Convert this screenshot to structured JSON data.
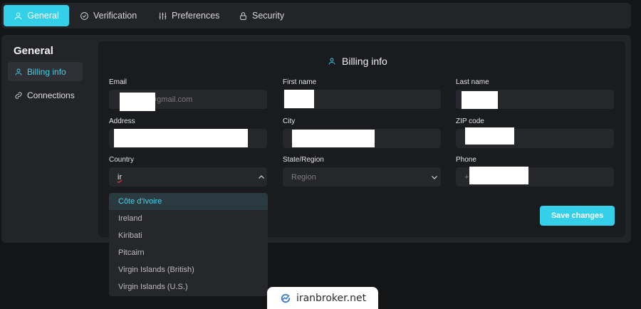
{
  "tabs": [
    {
      "label": "General",
      "icon": "user-icon",
      "active": true
    },
    {
      "label": "Verification",
      "icon": "check-circle-icon"
    },
    {
      "label": "Preferences",
      "icon": "sliders-icon"
    },
    {
      "label": "Security",
      "icon": "lock-icon"
    }
  ],
  "sidebar": {
    "title": "General",
    "items": [
      {
        "label": "Billing info",
        "icon": "user-icon",
        "active": true
      },
      {
        "label": "Connections",
        "icon": "link-icon"
      }
    ]
  },
  "billing": {
    "title": "Billing info",
    "email": {
      "label": "Email",
      "value": "@gmail.com"
    },
    "first_name": {
      "label": "First name"
    },
    "last_name": {
      "label": "Last name"
    },
    "address": {
      "label": "Address"
    },
    "city": {
      "label": "City"
    },
    "zip": {
      "label": "ZIP code"
    },
    "country": {
      "label": "Country",
      "value": "ir"
    },
    "state": {
      "label": "State/Region",
      "placeholder": "Region"
    },
    "phone": {
      "label": "Phone",
      "value": "+"
    },
    "save_label": "Save changes"
  },
  "country_options": [
    "Côte d'Ivoire",
    "Ireland",
    "Kiribati",
    "Pitcairn",
    "Virgin Islands (British)",
    "Virgin Islands (U.S.)"
  ],
  "watermark": "iranbroker.net",
  "colors": {
    "accent": "#34d0ea",
    "background": "#141517",
    "panel": "#232428",
    "card": "#1a1b1e",
    "field": "#26272b"
  }
}
